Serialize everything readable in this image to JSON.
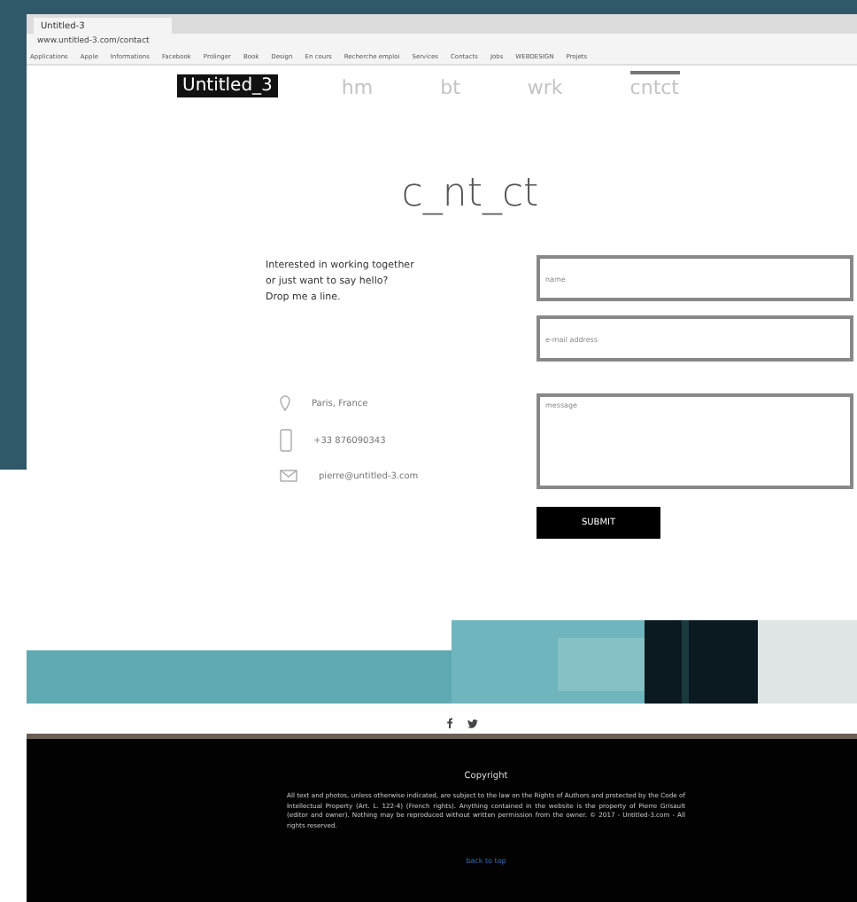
{
  "browser": {
    "tab_title": "Untitled-3",
    "address": "www.untitled-3.com/contact",
    "bookmarks": [
      "Applications",
      "Apple",
      "Informations",
      "Facebook",
      "Prolinger",
      "Book",
      "Design",
      "En cours",
      "Recherche emploi",
      "Services",
      "Contacts",
      "Jobs",
      "WEBDESIGN",
      "Projets"
    ]
  },
  "nav": {
    "logo": "Untitled_3",
    "items": [
      {
        "label": "hm",
        "selected": false
      },
      {
        "label": "bt",
        "selected": false
      },
      {
        "label": "wrk",
        "selected": false
      },
      {
        "label": "cntct",
        "selected": true
      }
    ]
  },
  "heading": "c_nt_ct",
  "intro": [
    "Interested in working together",
    "or just want to say hello?",
    "Drop me a line."
  ],
  "contact_details": [
    {
      "kind": "location",
      "text": "Paris, France"
    },
    {
      "kind": "phone",
      "text": "+33 876090343"
    },
    {
      "kind": "mail",
      "text": "pierre@untitled-3.com"
    }
  ],
  "form": {
    "fields": [
      {
        "kind": "input",
        "placeholder": "name"
      },
      {
        "kind": "input",
        "placeholder": "e-mail address"
      },
      {
        "kind": "textarea",
        "placeholder": "message"
      }
    ],
    "submit": "SUBMIT"
  },
  "banner": {
    "kind": "picture"
  },
  "social": [
    {
      "kind": "facebook"
    },
    {
      "kind": "twitter"
    }
  ],
  "footer": {
    "title": "Copyright",
    "text": "All text and photos, unless otherwise indicated, are subject to the law on the Rights of Authors and protected by the Code of Intellectual Property (Art. L. 122-4) (French rights). Anything contained in the website is the property of Pierre Grisault (editor and owner). Nothing may be reproduced without written permission from the owner. © 2017 - Untitled-3.com - All rights reserved.",
    "link": "back to top"
  }
}
